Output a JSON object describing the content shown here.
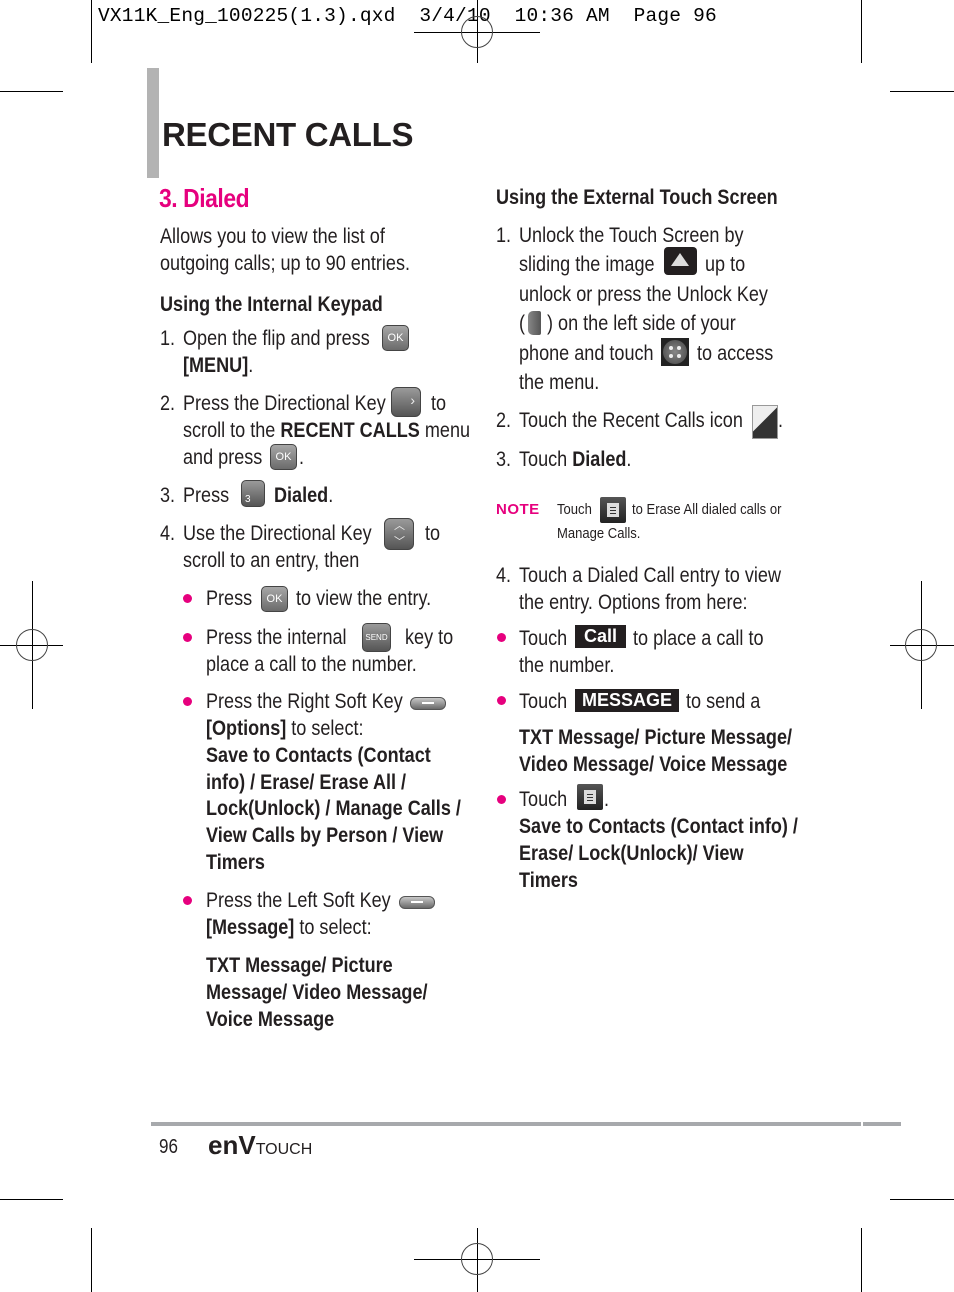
{
  "slug": "VX11K_Eng_100225(1.3).qxd  3/4/10  10:36 AM  Page 96",
  "header": {
    "title": "RECENT CALLS"
  },
  "section": {
    "title": "3. Dialed",
    "intro_line1": "Allows you to view the list of",
    "intro_line2": "outgoing calls; up to 90 entries."
  },
  "left": {
    "heading": "Using the Internal Keypad",
    "step1": {
      "num": "1.",
      "text": "Open the flip and press",
      "key": "OK",
      "line2": "[MENU]",
      "line2_end": "."
    },
    "step2": {
      "num": "2.",
      "text": "Press the Directional Key",
      "after": "to",
      "line2_a": "scroll to the ",
      "line2_b": "RECENT CALLS",
      "line2_c": " menu",
      "line3": "and press",
      "key": "OK",
      "end": "."
    },
    "step3": {
      "num": "3.",
      "text": "Press",
      "key": "3",
      "bold": "Dialed",
      "end": "."
    },
    "step4": {
      "num": "4.",
      "text": "Use the Directional Key",
      "after": "to",
      "line2": "scroll to an entry, then"
    },
    "bullets": [
      {
        "a": "Press",
        "key": "OK",
        "b": "to view the entry."
      },
      {
        "a": "Press the internal",
        "key": "SEND",
        "b": "key to",
        "line2": "place a call to the number."
      },
      {
        "a": "Press the Right Soft Key",
        "line2_bold": "[Options]",
        "line2": " to select:",
        "options": [
          "Save to Contacts (Contact",
          "info) / Erase/ Erase All /",
          "Lock(Unlock) / Manage Calls /",
          "View Calls by Person / View",
          "Timers"
        ]
      },
      {
        "a": "Press the Left Soft Key",
        "line2_bold": "[Message]",
        "line2": " to select:",
        "options": [
          "TXT Message/ Picture",
          "Message/ Video Message/",
          "Voice Message"
        ]
      }
    ]
  },
  "right": {
    "heading": "Using the External Touch Screen",
    "step1": {
      "num": "1.",
      "l1": "Unlock the Touch Screen by",
      "l2a": "sliding the image",
      "l2b": "up to",
      "l3": "unlock or press the Unlock Key",
      "l4a": "(",
      "l4b": ") on the left side of your",
      "l5a": "phone and touch",
      "l5b": "to access",
      "l6": "the menu."
    },
    "step2": {
      "num": "2.",
      "text": "Touch the Recent Calls icon",
      "end": "."
    },
    "step3": {
      "num": "3.",
      "text": "Touch ",
      "bold": "Dialed",
      "end": "."
    },
    "note": {
      "label": "NOTE",
      "a": "Touch",
      "b": "to Erase All dialed calls or",
      "line2": "Manage Calls."
    },
    "step4": {
      "num": "4.",
      "l1": "Touch a Dialed Call entry to view",
      "l2": "the entry. Options from here:"
    },
    "bullets": [
      {
        "a": "Touch",
        "button": "Call",
        "b": "to place a call to",
        "line2": "the number."
      },
      {
        "a": "Touch",
        "button": "MESSAGE",
        "b": "to send a",
        "options": [
          "TXT Message/ Picture Message/",
          "Video Message/ Voice Message"
        ]
      },
      {
        "a": "Touch",
        "end": ".",
        "options": [
          "Save to Contacts (Contact info) /",
          "Erase/ Lock(Unlock)/ View",
          "Timers"
        ]
      }
    ]
  },
  "footer": {
    "page_number": "96",
    "brand_main": "enV",
    "brand_sub": "TOUCH"
  },
  "colors": {
    "accent": "#e6007e",
    "text": "#231f20",
    "rule": "#a7a9ac"
  }
}
